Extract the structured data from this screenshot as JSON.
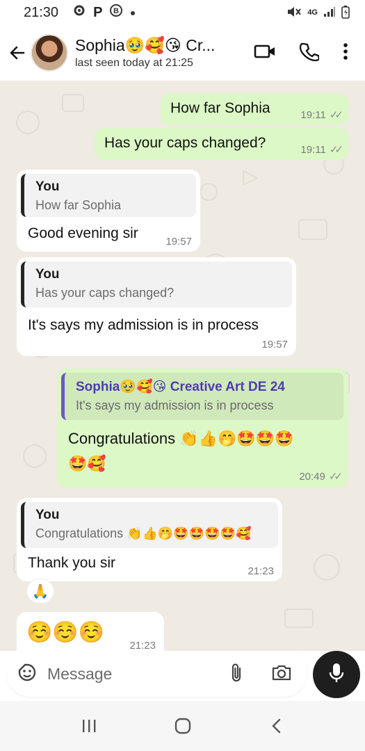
{
  "status_bar": {
    "time": "21:30",
    "left_icons": [
      "gear-icon",
      "p-icon",
      "b-icon",
      "dot-icon"
    ],
    "network": "4G",
    "right_icons": [
      "mute-icon",
      "network-4g-icon",
      "signal-icon",
      "battery-icon"
    ]
  },
  "header": {
    "name": "Sophia🥹🥰😘 Cr...",
    "status": "last seen today at 21:25",
    "actions": [
      "video-call-icon",
      "voice-call-icon",
      "more-options-icon"
    ]
  },
  "messages": [
    {
      "dir": "out",
      "text": "How far Sophia",
      "time": "19:11",
      "status": "read"
    },
    {
      "dir": "out",
      "text": "Has your caps changed?",
      "time": "19:11",
      "status": "read"
    },
    {
      "dir": "in",
      "quote_name": "You",
      "quote_text": "How far Sophia",
      "text": "Good evening sir",
      "time": "19:57"
    },
    {
      "dir": "in",
      "quote_name": "You",
      "quote_text": "Has your caps changed?",
      "text": "It's says my admission is in process",
      "time": "19:57"
    },
    {
      "dir": "out",
      "quote_name": "Sophia🥹🥰😘 Creative Art DE 24",
      "quote_text": "It's says my admission is in process",
      "text_line1": "Congratulations 👏👍🤭🤩🤩🤩",
      "text_line2": "🤩🥰",
      "time": "20:49",
      "status": "read"
    },
    {
      "dir": "in",
      "quote_name": "You",
      "quote_text": "Congratulations 👏👍🤭🤩🤩🤩🤩🥰",
      "text": "Thank you sir",
      "time": "21:23",
      "reaction": "🙏"
    },
    {
      "dir": "in",
      "text": "☺️☺️☺️",
      "time": "21:23"
    }
  ],
  "composer": {
    "placeholder": "Message",
    "icons": [
      "sticker-icon",
      "attach-icon",
      "camera-icon",
      "mic-icon"
    ]
  },
  "nav": [
    "recents-icon",
    "home-icon",
    "back-nav-icon"
  ],
  "colors": {
    "chat_bg": "#efeae2",
    "outgoing_bubble": "#dcf8c6",
    "incoming_bubble": "#ffffff",
    "quote_out_bar": "#6f56c9",
    "mic_button": "#1e1e1e"
  }
}
